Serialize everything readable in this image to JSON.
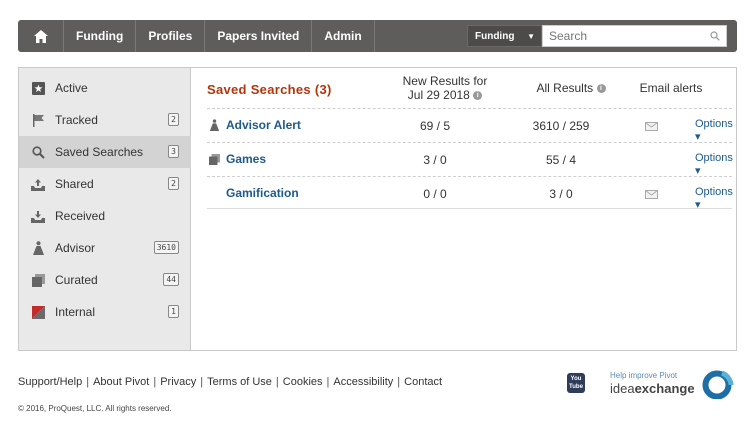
{
  "nav": {
    "items": [
      "Funding",
      "Profiles",
      "Papers Invited",
      "Admin"
    ],
    "search_scope": "Funding",
    "search_placeholder": "Search"
  },
  "sidebar": {
    "items": [
      {
        "label": "Active",
        "count": "",
        "icon": "active-icon"
      },
      {
        "label": "Tracked",
        "count": "2",
        "icon": "flag-icon"
      },
      {
        "label": "Saved Searches",
        "count": "3",
        "icon": "search-icon"
      },
      {
        "label": "Shared",
        "count": "2",
        "icon": "shared-tray-icon"
      },
      {
        "label": "Received",
        "count": "",
        "icon": "received-tray-icon"
      },
      {
        "label": "Advisor",
        "count": "3610",
        "icon": "advisor-icon"
      },
      {
        "label": "Curated",
        "count": "44",
        "icon": "curated-stack-icon"
      },
      {
        "label": "Internal",
        "count": "1",
        "icon": "internal-flag-icon"
      }
    ],
    "active_index": 2
  },
  "table": {
    "title": "Saved Searches  (3)",
    "col_new_line1": "New Results for",
    "col_new_line2": "Jul 29 2018",
    "col_all": "All Results",
    "col_email": "Email alerts",
    "rows": [
      {
        "name": "Advisor Alert",
        "new": "69 / 5",
        "all": "3610 / 259",
        "email": true,
        "options": "Options"
      },
      {
        "name": "Games",
        "new": "3 / 0",
        "all": "55 / 4",
        "email": false,
        "options": "Options"
      },
      {
        "name": "Gamification",
        "new": "0 / 0",
        "all": "3 / 0",
        "email": true,
        "options": "Options"
      }
    ]
  },
  "footer": {
    "links": [
      "Support/Help",
      "About Pivot",
      "Privacy",
      "Terms of Use",
      "Cookies",
      "Accessibility",
      "Contact"
    ],
    "copyright": "© 2016, ProQuest, LLC. All rights reserved.",
    "youtube_line1": "You",
    "youtube_line2": "Tube",
    "help_small": "Help improve Pivot",
    "idea_a": "idea",
    "idea_b": "exchange"
  },
  "colors": {
    "nav_bg": "#5f5c5c",
    "title": "#b2360d",
    "link": "#1e5a8a",
    "sidebar_bg": "#e9e9e9"
  }
}
